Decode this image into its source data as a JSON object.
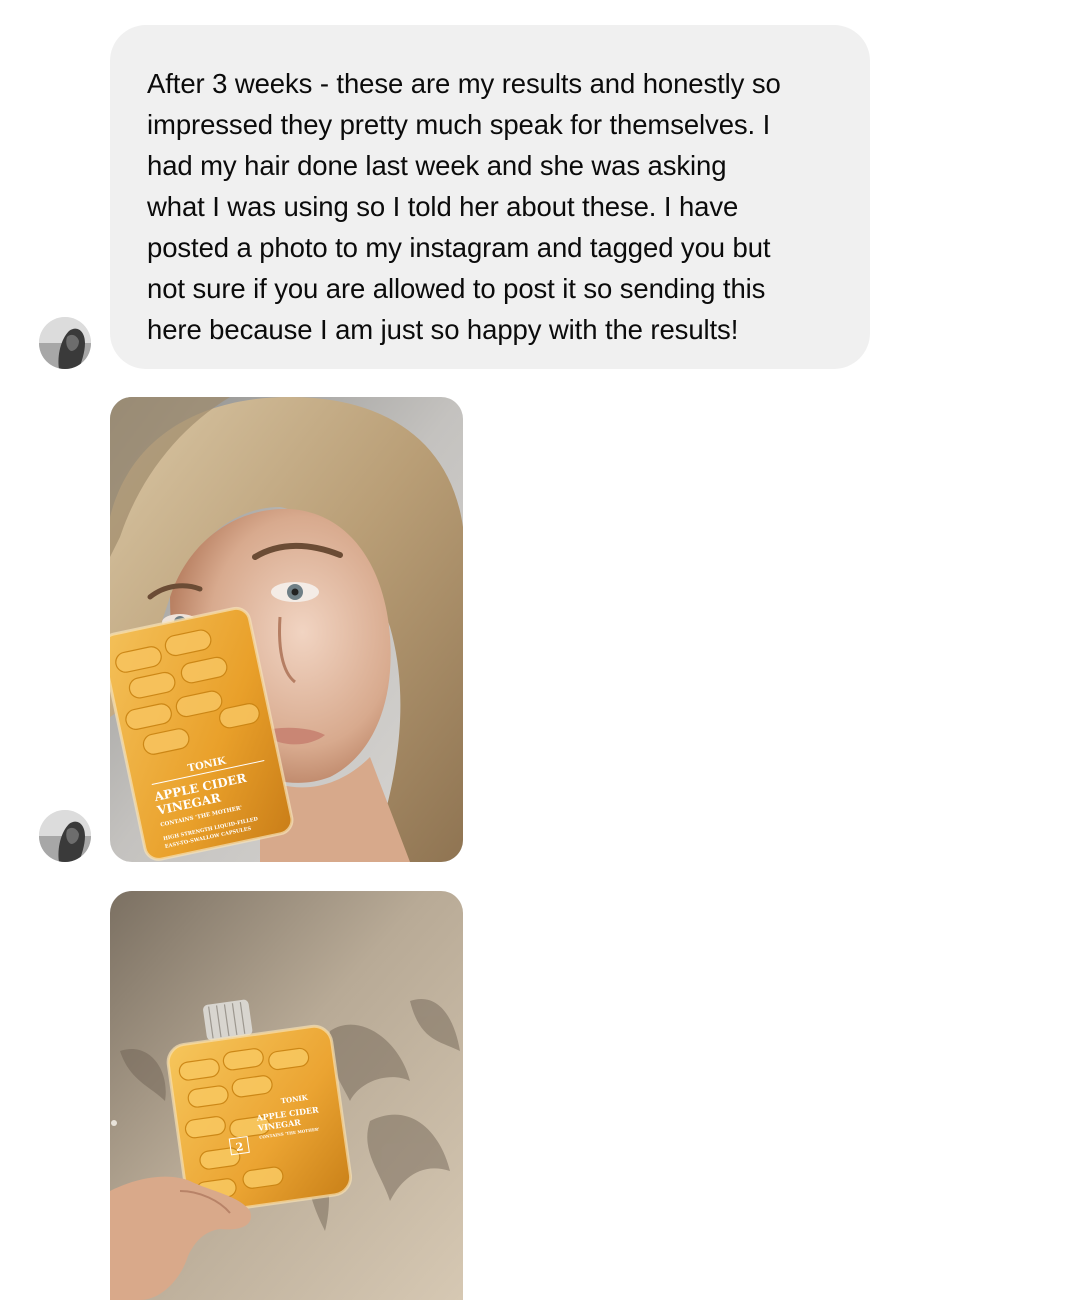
{
  "conversation": {
    "messages": [
      {
        "type": "text",
        "text": "After 3 weeks - these are my results and honestly so\nimpressed they pretty much speak for themselves. I\nhad my hair done last week and she was asking\nwhat I was using so I told her about these. I have\nposted a photo to my instagram and tagged you but\nnot sure if you are allowed to post it so sending this\nhere because I am just so happy with the results!"
      },
      {
        "type": "image",
        "alt": "Photo"
      },
      {
        "type": "image",
        "alt": "Photo"
      }
    ],
    "product_label": {
      "brand": "TONIK",
      "name_line1": "APPLE CIDER",
      "name_line2": "VINEGAR",
      "sub1": "CONTAINS 'THE MOTHER'",
      "sub2": "HIGH STRENGTH LIQUID-FILLED",
      "sub3": "EASY-TO-SWALLOW CAPSULES",
      "number": "2"
    }
  },
  "colors": {
    "bubble_bg": "#f0f0f0",
    "text": "#0b0b0b",
    "capsule": "#e8a21c"
  }
}
